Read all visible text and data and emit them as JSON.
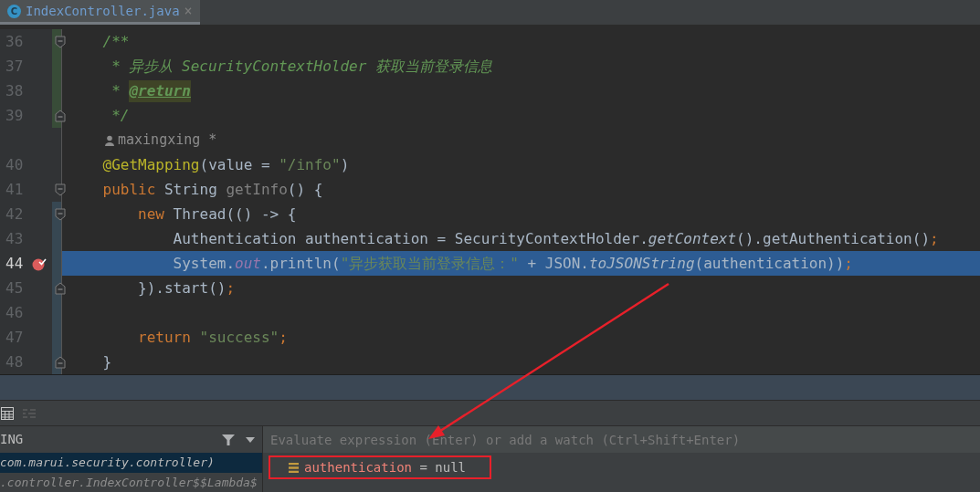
{
  "tabs": [
    {
      "icon_letter": "C",
      "label": "IndexController.java",
      "close": "×",
      "selected": true
    }
  ],
  "editor": {
    "lines": [
      {
        "number": "36",
        "added": true,
        "modified": false,
        "selected": false,
        "breakpoint": false,
        "fold_marker": {
          "kind": "start"
        },
        "tokens": [
          {
            "kind": "doc",
            "text": "    /**"
          }
        ]
      },
      {
        "number": "37",
        "added": true,
        "modified": false,
        "selected": false,
        "breakpoint": false,
        "tokens": [
          {
            "kind": "doc",
            "text": "     * 异步从 SecurityContextHolder 获取当前登录信息"
          }
        ]
      },
      {
        "number": "38",
        "added": true,
        "modified": false,
        "selected": false,
        "breakpoint": false,
        "tokens": [
          {
            "kind": "doc",
            "text": "     * "
          },
          {
            "kind": "doctag",
            "text": "@return"
          }
        ]
      },
      {
        "number": "39",
        "added": true,
        "modified": false,
        "selected": false,
        "breakpoint": false,
        "fold_marker": {
          "kind": "end"
        },
        "tokens": [
          {
            "kind": "doc",
            "text": "     */"
          }
        ]
      },
      {
        "kind": "author",
        "added": false,
        "modified": false,
        "text": "maxingxing *"
      },
      {
        "number": "40",
        "added": false,
        "modified": false,
        "selected": false,
        "breakpoint": false,
        "tokens": [
          {
            "kind": "annotation",
            "text": "    @GetMapping"
          },
          {
            "kind": "plain",
            "text": "(value = "
          },
          {
            "kind": "string",
            "text": "\"/info\""
          },
          {
            "kind": "plain",
            "text": ")"
          }
        ]
      },
      {
        "number": "41",
        "added": false,
        "modified": false,
        "selected": false,
        "breakpoint": false,
        "fold_marker": {
          "kind": "start"
        },
        "tokens": [
          {
            "kind": "keyword",
            "text": "    public "
          },
          {
            "kind": "plain",
            "text": "String "
          },
          {
            "kind": "unused",
            "text": "getInfo"
          },
          {
            "kind": "plain",
            "text": "() {"
          }
        ]
      },
      {
        "number": "42",
        "added": false,
        "modified": true,
        "selected": false,
        "breakpoint": false,
        "fold_marker": {
          "kind": "start"
        },
        "tokens": [
          {
            "kind": "keyword",
            "text": "        new "
          },
          {
            "kind": "plain",
            "text": "Thread(() -> {"
          }
        ]
      },
      {
        "number": "43",
        "added": false,
        "modified": true,
        "selected": false,
        "breakpoint": false,
        "tokens": [
          {
            "kind": "plain",
            "text": "            Authentication authentication = SecurityContextHolder."
          },
          {
            "kind": "static",
            "text": "getContext"
          },
          {
            "kind": "plain",
            "text": "().getAuthentication()"
          },
          {
            "kind": "keyword",
            "text": ";"
          }
        ]
      },
      {
        "number": "44",
        "added": false,
        "modified": true,
        "selected": true,
        "breakpoint": true,
        "tokens": [
          {
            "kind": "plain",
            "text": "            System."
          },
          {
            "kind": "field",
            "text": "out"
          },
          {
            "kind": "plain",
            "text": ".println("
          },
          {
            "kind": "string",
            "text": "\"异步获取当前登录信息：\""
          },
          {
            "kind": "plain",
            "text": " + JSON."
          },
          {
            "kind": "static",
            "text": "toJSONString"
          },
          {
            "kind": "plain",
            "text": "(authentication))"
          },
          {
            "kind": "keyword",
            "text": ";"
          }
        ]
      },
      {
        "number": "45",
        "added": false,
        "modified": true,
        "selected": false,
        "breakpoint": false,
        "fold_marker": {
          "kind": "end"
        },
        "tokens": [
          {
            "kind": "plain",
            "text": "        }).start()"
          },
          {
            "kind": "keyword",
            "text": ";"
          }
        ]
      },
      {
        "number": "46",
        "added": false,
        "modified": true,
        "selected": false,
        "breakpoint": false
      },
      {
        "number": "47",
        "added": false,
        "modified": true,
        "selected": false,
        "breakpoint": false,
        "tokens": [
          {
            "kind": "keyword",
            "text": "        return "
          },
          {
            "kind": "string",
            "text": "\"success\""
          },
          {
            "kind": "keyword",
            "text": ";"
          }
        ]
      },
      {
        "number": "48",
        "added": false,
        "modified": true,
        "selected": false,
        "breakpoint": false,
        "fold_marker": {
          "kind": "end"
        },
        "tokens": [
          {
            "kind": "plain",
            "text": "    }"
          }
        ]
      }
    ]
  },
  "debug": {
    "frames_header": "ING",
    "frames": [
      {
        "text": "com.marui.security.controller)",
        "selected": true
      },
      {
        "text": ".controller.IndexController$$Lambda$",
        "selected": false
      }
    ],
    "evaluate_placeholder": "Evaluate expression (Enter) or add a watch (Ctrl+Shift+Enter)",
    "variables": [
      {
        "name": "authentication",
        "value": " = null",
        "highlighted": true
      }
    ]
  }
}
